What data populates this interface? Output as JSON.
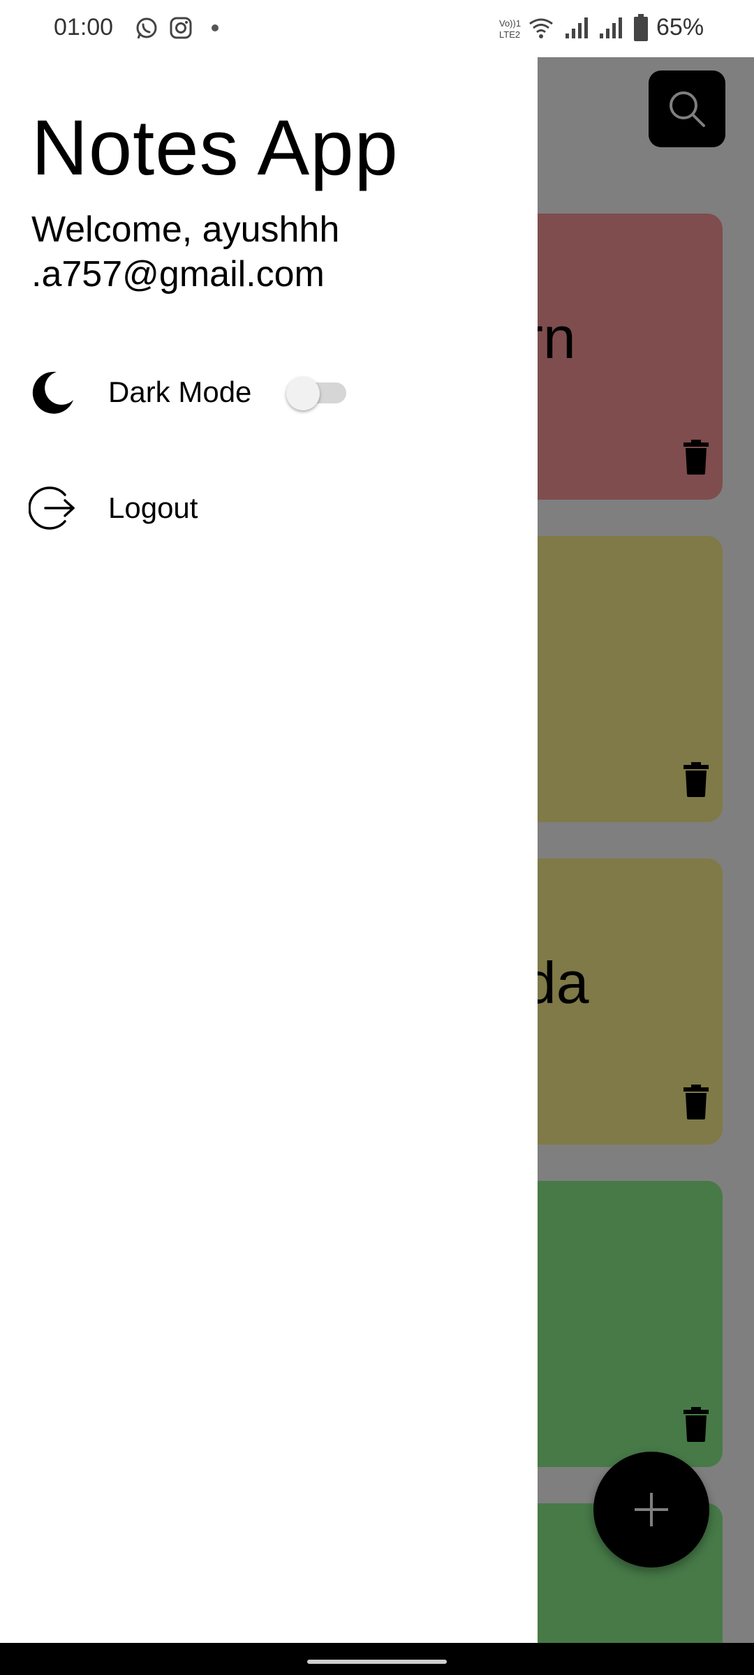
{
  "status_bar": {
    "time": "01:00",
    "battery_percent": "65%",
    "icons": [
      "whatsapp-icon",
      "instagram-icon",
      "dot-icon",
      "volte-icon",
      "wifi-icon",
      "signal-icon",
      "signal-icon",
      "battery-icon"
    ]
  },
  "drawer": {
    "title": "Notes App",
    "welcome": "Welcome, ayushhh .a757@gmail.com",
    "items": [
      {
        "label": "Dark Mode",
        "icon": "moon-icon",
        "toggle_on": false
      },
      {
        "label": "Logout",
        "icon": "logout-icon"
      }
    ]
  },
  "background": {
    "notes": [
      {
        "text": "rn",
        "color": "#fe9b9b"
      },
      {
        "text": "",
        "color": "#fff48f"
      },
      {
        "text": "da",
        "color": "#fff48f"
      },
      {
        "text": "",
        "color": "#8ef48f"
      },
      {
        "text": "",
        "color": "#8ef48f"
      }
    ],
    "fab_icon": "plus-icon",
    "search_icon": "search-icon"
  },
  "colors": {
    "scrim": "rgba(0,0,0,0.5)",
    "drawer_bg": "#ffffff"
  }
}
